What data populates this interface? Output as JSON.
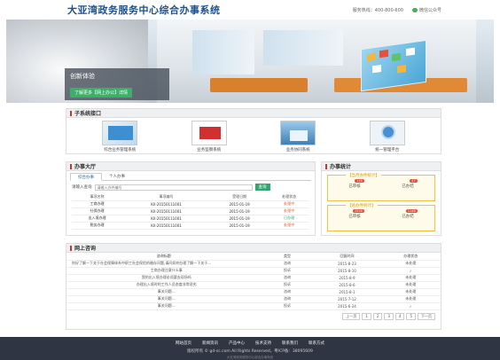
{
  "header": {
    "title": "大亚湾政务服务中心综合办事系统",
    "hotline": "服务热线：400-800-600",
    "wechat": "微信公众号"
  },
  "banner": {
    "card_title": "创新体验",
    "button_label": "了解更多【网上办公】详情"
  },
  "systems": {
    "title": "子系统接口",
    "items": [
      {
        "label": "综合业务管理系统"
      },
      {
        "label": "业务监察系统"
      },
      {
        "label": "业务协同系统"
      },
      {
        "label": "统一管理平台"
      }
    ]
  },
  "hall": {
    "title": "办事大厅",
    "tabs": [
      "综合办事",
      "个人办事"
    ],
    "search_label": "请输入查询",
    "search_placeholder": "请输入办件编号",
    "search_button": "查询",
    "columns": [
      "事项名称",
      "事项编号",
      "受理日期",
      "处理状态"
    ],
    "rows": [
      {
        "name": "工商办理",
        "code": "KX-20150111001",
        "date": "2015-01-19",
        "status": "处理中",
        "ok": false
      },
      {
        "name": "社保办理",
        "code": "KX-20150111001",
        "date": "2015-01-19",
        "status": "处理中",
        "ok": false
      },
      {
        "name": "出入境办理",
        "code": "KX-20150111001",
        "date": "2015-01-19",
        "status": "已办理",
        "ok": true
      },
      {
        "name": "税务办理",
        "code": "KX-20150111001",
        "date": "2015-01-19",
        "status": "处理中",
        "ok": false
      }
    ]
  },
  "stats": {
    "title": "办事统计",
    "cards": [
      {
        "title": "【当月办件统计】",
        "items": [
          {
            "label": "已审核",
            "count": "116"
          },
          {
            "label": "已办结",
            "count": "47"
          }
        ]
      },
      {
        "title": "【总办件统计】",
        "items": [
          {
            "label": "已审核",
            "count": "1516"
          },
          {
            "label": "已办结",
            "count": "1148"
          }
        ]
      }
    ]
  },
  "public": {
    "title": "网上咨询",
    "columns": [
      "咨询标题",
      "类型",
      "回复时间",
      "办理状态"
    ],
    "rows": [
      {
        "title": "你好了解一下关于社会保障体系中职工社会保险的缴存问题,请问如何办理了解一下关于...",
        "type": "咨询",
        "date": "2015-8-23",
        "status": "未处理",
        "ok": false
      },
      {
        "title": "工商办理注意什么事",
        "type": "投诉",
        "date": "2015-8-10",
        "status": "✓",
        "ok": true
      },
      {
        "title": "我的出入境办理必须要去现场吗",
        "type": "咨询",
        "date": "2015-8-9",
        "status": "未处理",
        "ok": false
      },
      {
        "title": "办理出入境时的工作人员态度非常恶劣",
        "type": "投诉",
        "date": "2015-8-6",
        "status": "未处理",
        "ok": false
      },
      {
        "title": "事关问题...",
        "type": "咨询",
        "date": "2015-8-1",
        "status": "未处理",
        "ok": false
      },
      {
        "title": "事关问题...",
        "type": "咨询",
        "date": "2015-7-12",
        "status": "未处理",
        "ok": false
      },
      {
        "title": "事关问题...",
        "type": "投诉",
        "date": "2015-6-24",
        "status": "✓",
        "ok": true
      }
    ],
    "pager": [
      "上一页",
      "1",
      "2",
      "3",
      "4",
      "5",
      "下一页"
    ]
  },
  "footer": {
    "links": [
      "网站首页",
      "新闻资讯",
      "产品中心",
      "技术支持",
      "联系我们",
      "联系方式"
    ],
    "copyright": "版权所有 © gd-sc.com All Rights Reserved，粤ICP备：38095609",
    "note": "大亚湾政务服务中心综合办事系统"
  }
}
